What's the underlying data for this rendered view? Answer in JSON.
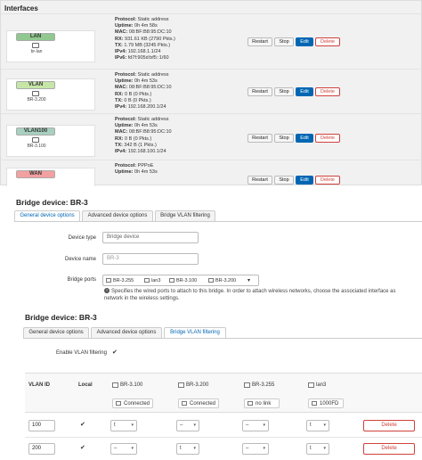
{
  "interfaces": {
    "title": "Interfaces",
    "rows": [
      {
        "name": "LAN",
        "badge_color": "#90c890",
        "device": "br-lan",
        "protocol": "Static address",
        "uptime": "0h 4m 58s",
        "mac": "08:BF:B8:95:DC:10",
        "rx": "931.61 KB (2790 Pkts.)",
        "tx": "1.79 MB (3245 Pkts.)",
        "ipv4": "192.168.1.1/24",
        "ipv6": "fd7f:905d:bf5::1/60"
      },
      {
        "name": "VLAN",
        "badge_color": "#c6e6a8",
        "device": "BR-3.200",
        "protocol": "Static address",
        "uptime": "0h 4m 53s",
        "mac": "08:BF:B8:95:DC:10",
        "rx": "0 B (0 Pkts.)",
        "tx": "0 B (0 Pkts.)",
        "ipv4": "192.168.200.1/24",
        "ipv6": ""
      },
      {
        "name": "VLAN100",
        "badge_color": "#a8d0c0",
        "device": "BR-3.100",
        "protocol": "Static address",
        "uptime": "0h 4m 53s",
        "mac": "08:BF:B8:95:DC:10",
        "rx": "0 B (0 Pkts.)",
        "tx": "342 B (1 Pkts.)",
        "ipv4": "192.168.100.1/24",
        "ipv6": ""
      },
      {
        "name": "WAN",
        "badge_color": "#f2a0a0",
        "device": "",
        "protocol": "PPPoE",
        "uptime": "0h 4m 53s",
        "mac": "",
        "rx": "",
        "tx": "",
        "ipv4": "",
        "ipv6": ""
      }
    ],
    "labels": {
      "protocol": "Protocol:",
      "uptime": "Uptime:",
      "mac": "MAC:",
      "rx": "RX:",
      "tx": "TX:",
      "ipv4": "IPv4:",
      "ipv6": "IPv6:"
    },
    "buttons": {
      "restart": "Restart",
      "stop": "Stop",
      "edit": "Edit",
      "delete": "Delete"
    }
  },
  "bridge1": {
    "title": "Bridge device: BR-3",
    "tabs": [
      "General device options",
      "Advanced device options",
      "Bridge VLAN filtering"
    ],
    "active_tab": 0,
    "device_type_label": "Device type",
    "device_type_value": "Bridge device",
    "device_name_label": "Device name",
    "device_name_value": "BR-3",
    "bridge_ports_label": "Bridge ports",
    "ports": [
      "BR-3.255",
      "lan3",
      "BR-3.100",
      "BR-3.200"
    ],
    "help_text": "Specifies the wired ports to attach to this bridge. In order to attach wireless networks, choose the associated interface as network in the wireless settings."
  },
  "bridge2": {
    "title": "Bridge device: BR-3",
    "tabs": [
      "General device options",
      "Advanced device options",
      "Bridge VLAN filtering"
    ],
    "active_tab": 2,
    "enable_label": "Enable VLAN filtering",
    "enable_checked": true,
    "table": {
      "headers": {
        "vlan_id": "VLAN ID",
        "local": "Local"
      },
      "ports": [
        {
          "name": "BR-3.100",
          "status": "Connected"
        },
        {
          "name": "BR-3.200",
          "status": "Connected"
        },
        {
          "name": "BR-3.255",
          "status": "no link"
        },
        {
          "name": "lan3",
          "status": "1000FD"
        }
      ],
      "rows": [
        {
          "vlan_id": "100",
          "local": true,
          "cells": [
            "t",
            "–",
            "–",
            "t"
          ],
          "delete_label": "Delete"
        },
        {
          "vlan_id": "200",
          "local": true,
          "cells": [
            "–",
            "t",
            "–",
            "t"
          ],
          "delete_label": "Delete"
        }
      ]
    }
  }
}
